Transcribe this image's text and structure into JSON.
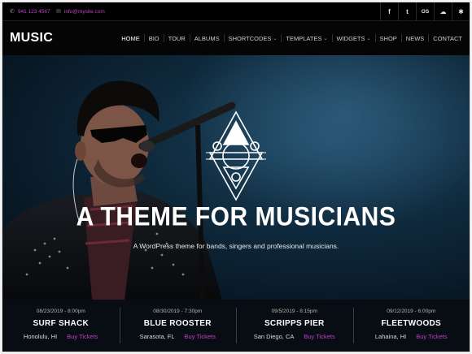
{
  "topbar": {
    "phone": "941 123 4567",
    "email": "info@mysite.com",
    "social": [
      {
        "icon": "facebook-icon",
        "glyph": "f"
      },
      {
        "icon": "twitter-icon",
        "glyph": "t"
      },
      {
        "icon": "lastfm-icon",
        "glyph": "OS"
      },
      {
        "icon": "soundcloud-icon",
        "glyph": "☁"
      },
      {
        "icon": "yelp-icon",
        "glyph": "✱"
      }
    ]
  },
  "header": {
    "logo": "MUSIC",
    "nav": [
      {
        "label": "HOME",
        "dropdown": false
      },
      {
        "label": "BIO",
        "dropdown": false
      },
      {
        "label": "TOUR",
        "dropdown": false
      },
      {
        "label": "ALBUMS",
        "dropdown": false
      },
      {
        "label": "SHORTCODES",
        "dropdown": true
      },
      {
        "label": "TEMPLATES",
        "dropdown": true
      },
      {
        "label": "WIDGETS",
        "dropdown": true
      },
      {
        "label": "SHOP",
        "dropdown": false
      },
      {
        "label": "NEWS",
        "dropdown": false
      },
      {
        "label": "CONTACT",
        "dropdown": false
      }
    ]
  },
  "hero": {
    "title": "A THEME FOR MUSICIANS",
    "subtitle": "A WordPress theme for bands, singers and professional musicians."
  },
  "events": [
    {
      "date": "08/23/2019 - 8:00pm",
      "venue": "SURF SHACK",
      "location": "Honolulu, HI",
      "cta": "Buy Tickets"
    },
    {
      "date": "08/30/2019 - 7:30pm",
      "venue": "BLUE ROOSTER",
      "location": "Sarasota, FL",
      "cta": "Buy Tickets"
    },
    {
      "date": "09/5/2019 - 8:15pm",
      "venue": "SCRIPPS PIER",
      "location": "San Diego, CA",
      "cta": "Buy Tickets"
    },
    {
      "date": "09/12/2019 - 6:00pm",
      "venue": "FLEETWOODS",
      "location": "Lahaina, HI",
      "cta": "Buy Tickets"
    }
  ],
  "colors": {
    "accent": "#c23fc7",
    "background": "#000000",
    "hero": "#0f2a3d"
  }
}
